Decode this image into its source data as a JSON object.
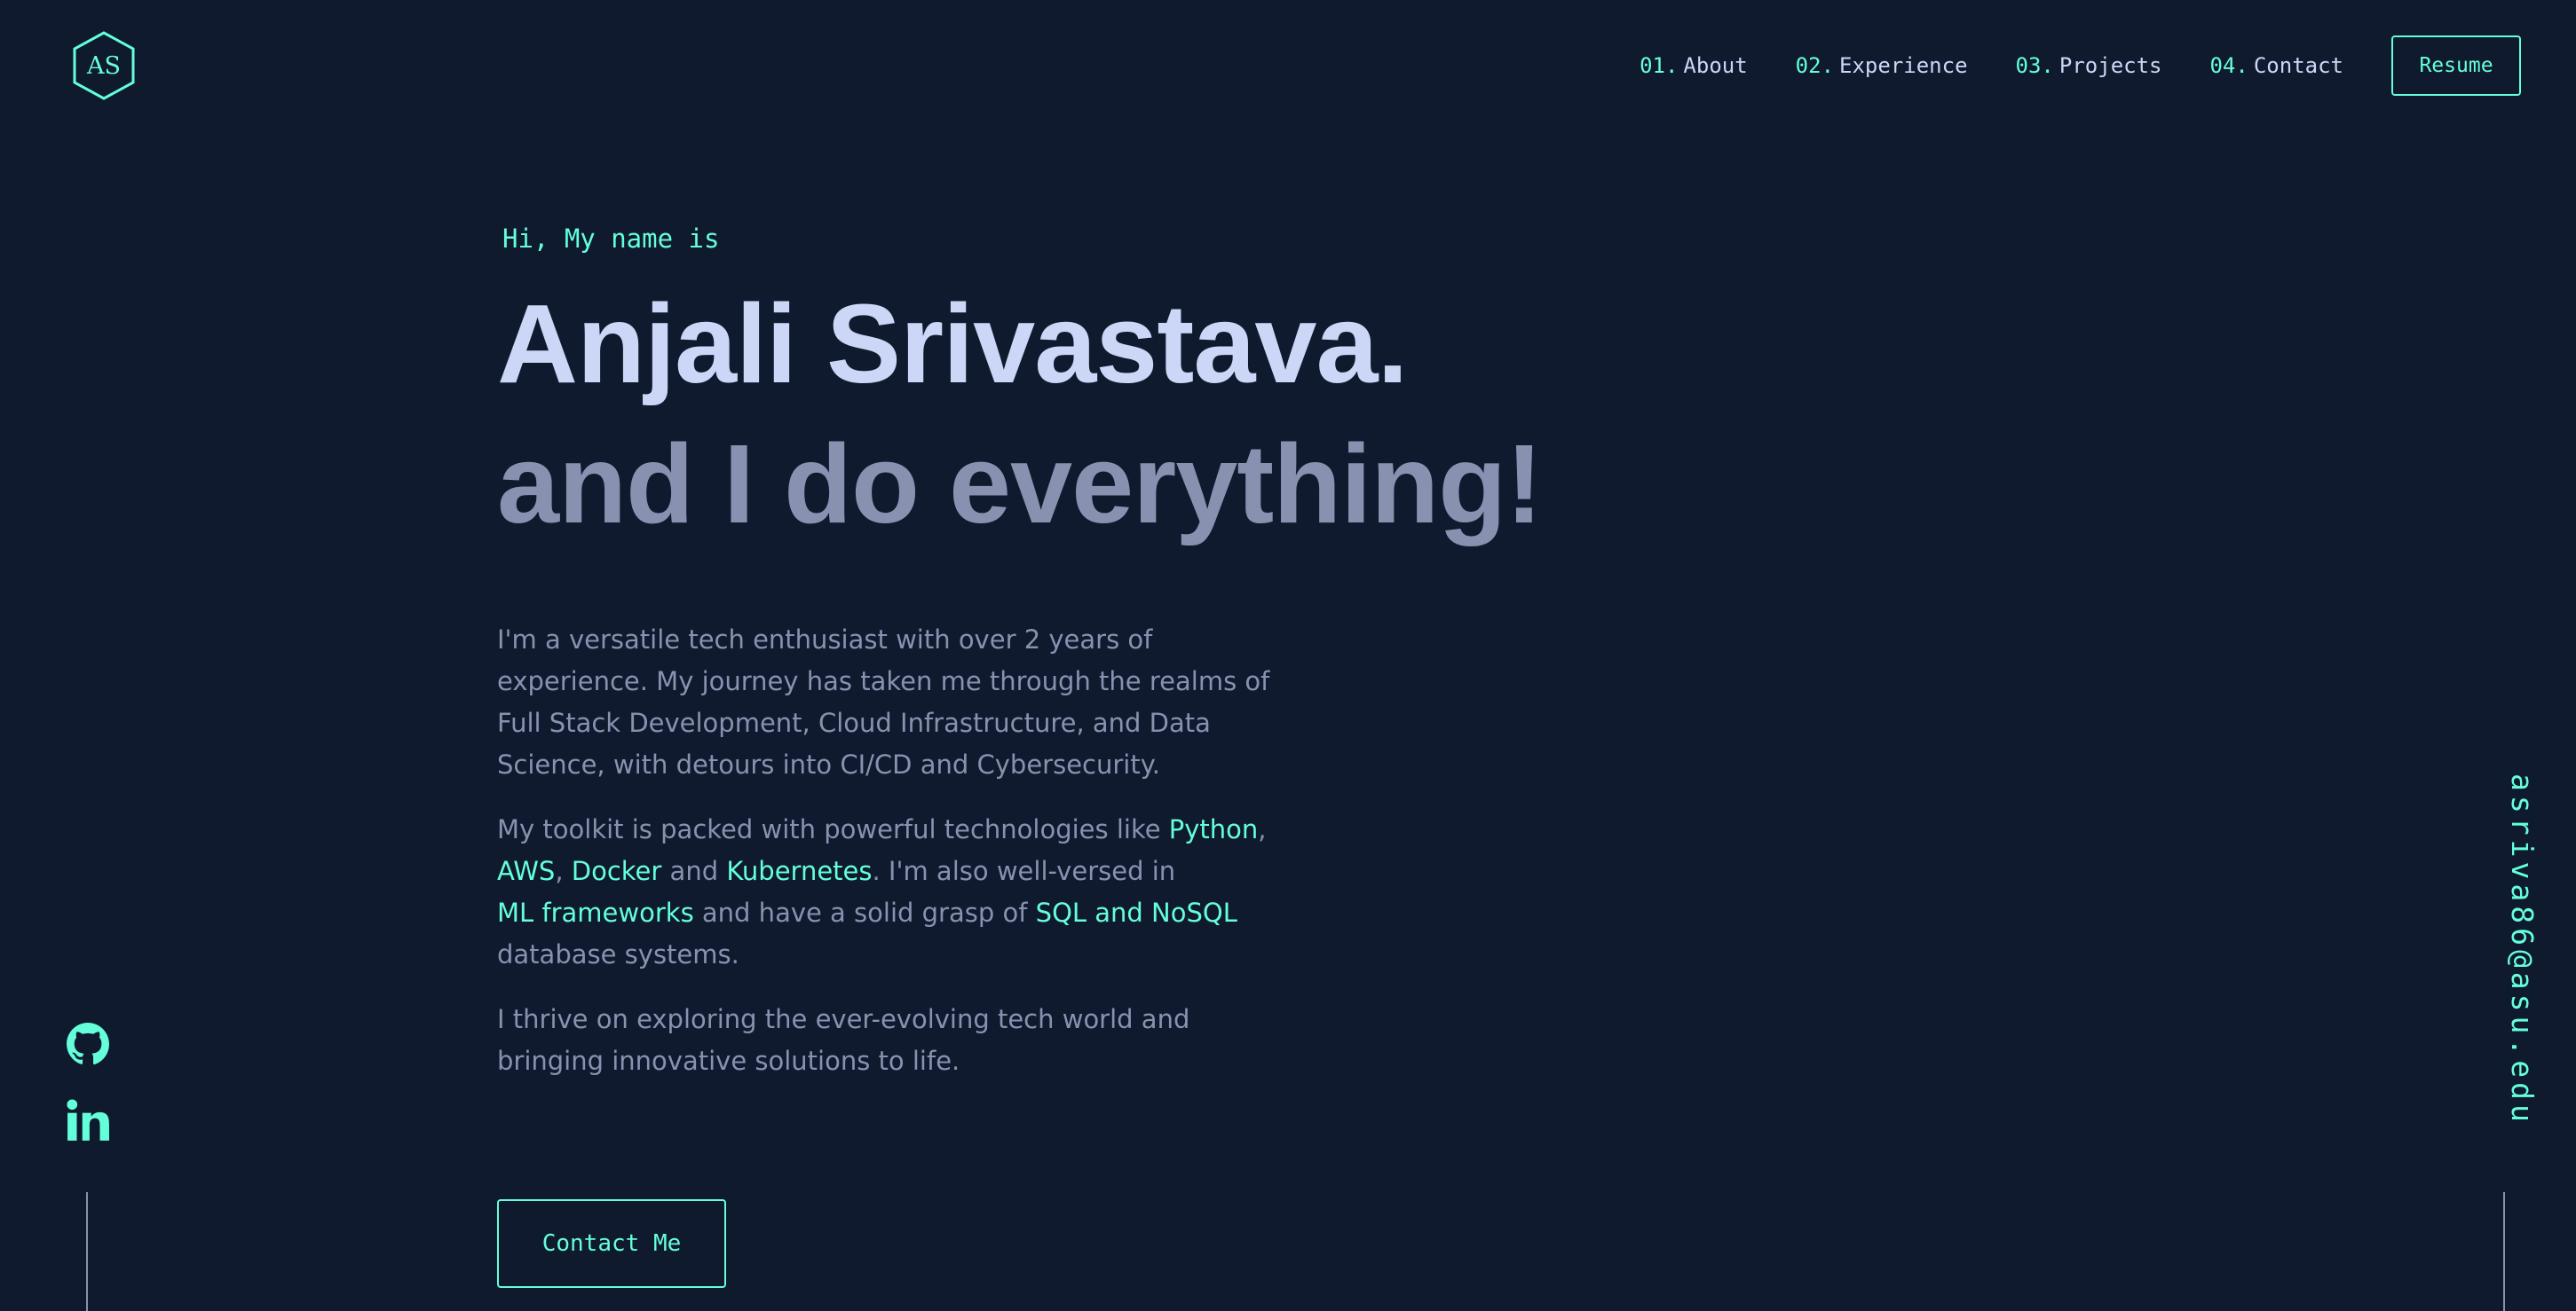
{
  "header": {
    "logo_text": "AS",
    "nav": [
      {
        "num": "01.",
        "label": "About"
      },
      {
        "num": "02.",
        "label": "Experience"
      },
      {
        "num": "03.",
        "label": "Projects"
      },
      {
        "num": "04.",
        "label": "Contact"
      }
    ],
    "resume_label": "Resume"
  },
  "hero": {
    "greeting": "Hi, My name is",
    "name": "Anjali Srivastava.",
    "tagline": "and I do everything!",
    "bio": {
      "p1": "I'm a versatile tech enthusiast with over 2 years of experience. My journey has taken me through the realms of Full Stack Development, Cloud Infrastructure, and Data Science, with detours into CI/CD and Cybersecurity.",
      "p2_parts": {
        "a": "My toolkit is packed with powerful technologies like ",
        "python": "Python",
        "b": ",",
        "aws": "AWS",
        "c": ", ",
        "docker": "Docker",
        "d": " and ",
        "kubernetes": "Kubernetes",
        "e": ". I'm also well-versed in",
        "ml": "ML frameworks",
        "f": " and have a solid grasp of ",
        "sql": "SQL and NoSQL",
        "g": "database systems."
      },
      "p3": "I thrive on exploring the ever-evolving tech world and bringing innovative solutions to life."
    },
    "contact_label": "Contact Me"
  },
  "side": {
    "email": "asriva86@asu.edu",
    "socials": [
      "github-icon",
      "linkedin-icon"
    ]
  },
  "colors": {
    "background": "#0f1a2e",
    "accent": "#64ffda",
    "heading": "#ccd6f6",
    "body": "#8892b0"
  }
}
